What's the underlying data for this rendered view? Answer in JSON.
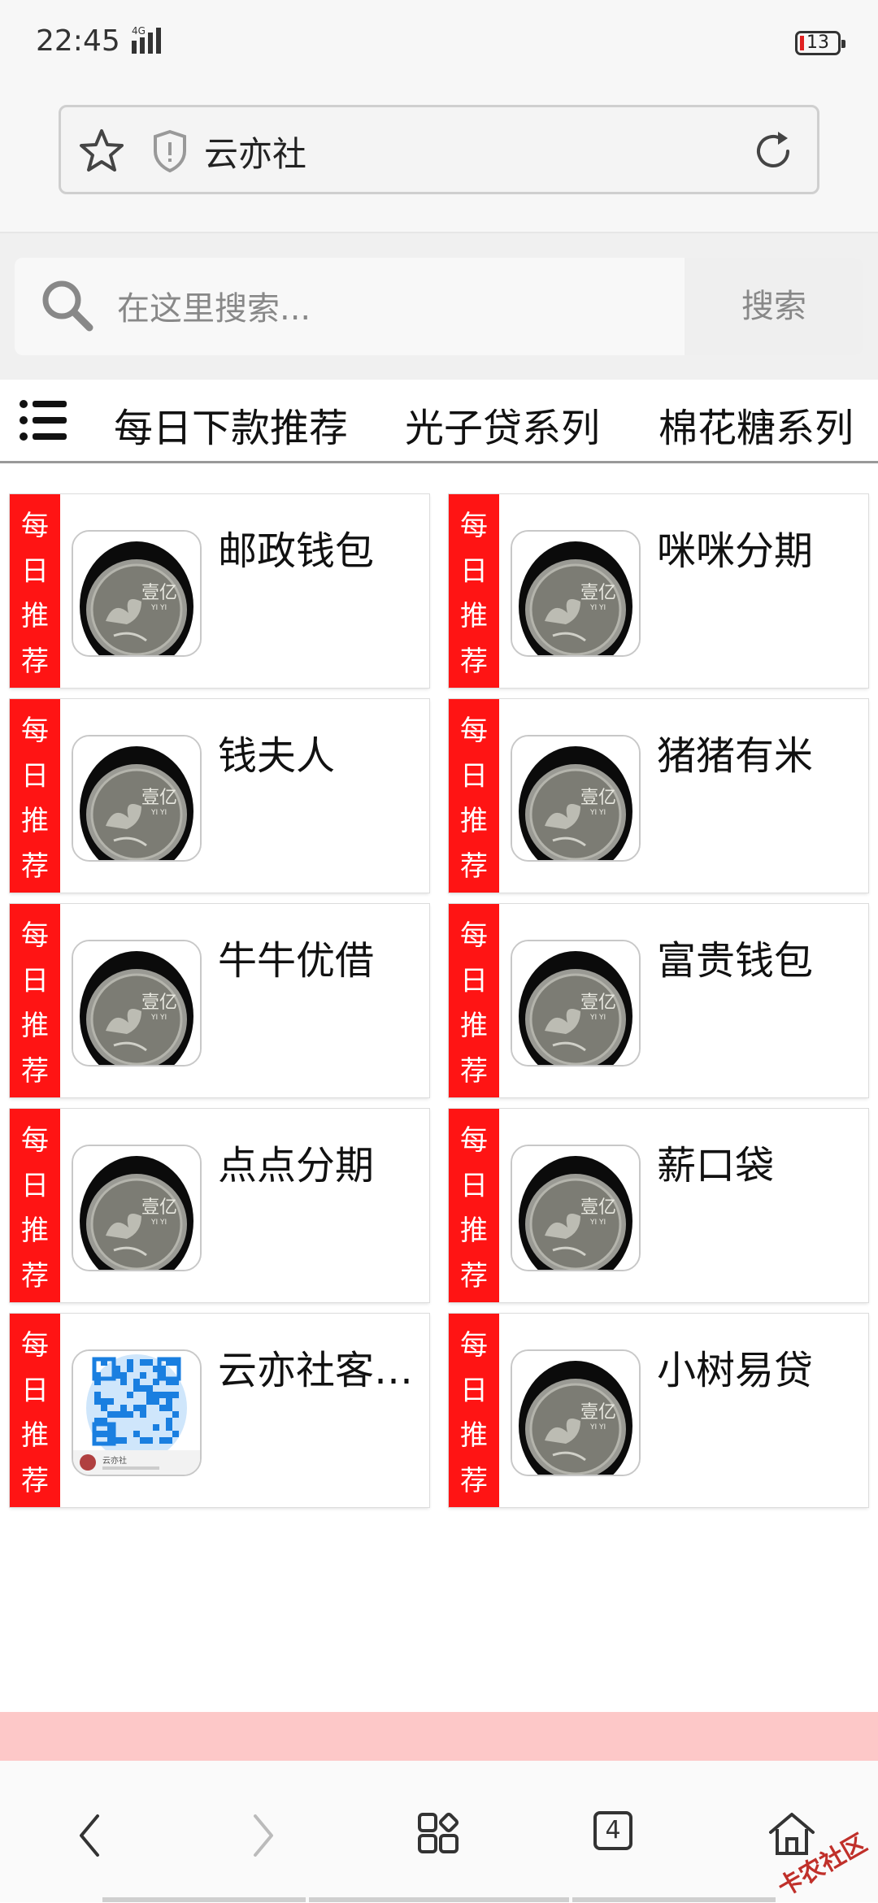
{
  "status": {
    "time": "22:45",
    "network": "4G",
    "battery": "13"
  },
  "address_bar": {
    "url_text": "云亦社"
  },
  "search": {
    "placeholder": "在这里搜索...",
    "button": "搜索"
  },
  "nav": {
    "tabs": [
      "每日下款推荐",
      "光子贷系列",
      "棉花糖系列"
    ]
  },
  "tag_chars": [
    "每",
    "日",
    "推",
    "荐"
  ],
  "cards": [
    {
      "name": "邮政钱包",
      "thumb": "coin"
    },
    {
      "name": "咪咪分期",
      "thumb": "coin"
    },
    {
      "name": "钱夫人",
      "thumb": "coin"
    },
    {
      "name": "猪猪有米",
      "thumb": "coin"
    },
    {
      "name": "牛牛优借",
      "thumb": "coin"
    },
    {
      "name": "富贵钱包",
      "thumb": "coin"
    },
    {
      "name": "点点分期",
      "thumb": "coin"
    },
    {
      "name": "薪口袋",
      "thumb": "coin"
    },
    {
      "name": "云亦社客服QQ",
      "thumb": "qr"
    },
    {
      "name": "小树易贷",
      "thumb": "coin"
    }
  ],
  "coin_text": "壹亿",
  "coin_subtext": "YI YI",
  "qr_caption": "云亦社",
  "bottom_nav": {
    "tab_count": "4"
  },
  "watermark": "卡农社区",
  "colors": {
    "tag_red": "#ff1414",
    "band_pink": "#fdc8c8"
  }
}
